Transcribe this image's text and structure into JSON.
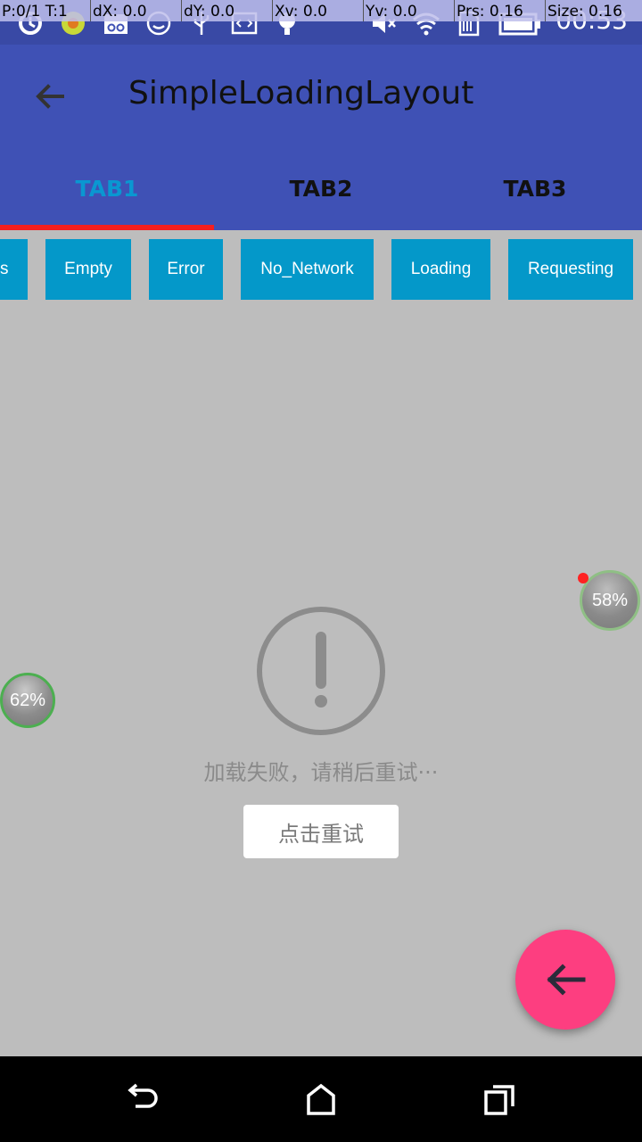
{
  "debug": {
    "p": "P:0/1 T:1",
    "dx": "dX: 0.0",
    "dy": "dY: 0.0",
    "xv": "Xv: 0.0",
    "yv": "Yv: 0.0",
    "prs": "Prs: 0.16",
    "size": "Size: 0.16"
  },
  "status_bar": {
    "time": "00:53",
    "icons": [
      "sync-icon",
      "app-icon",
      "incognito-icon",
      "face-icon",
      "usb-icon",
      "code-icon",
      "bulb-icon",
      "mute-icon",
      "wifi-icon",
      "no-sim-icon",
      "battery-icon"
    ]
  },
  "toolbar": {
    "title": "SimpleLoadingLayout"
  },
  "tabs": [
    {
      "label": "TAB1"
    },
    {
      "label": "TAB2"
    },
    {
      "label": "TAB3"
    }
  ],
  "state_buttons": [
    "s",
    "Empty",
    "Error",
    "No_Network",
    "Loading",
    "Requesting"
  ],
  "error_view": {
    "message": "加载失败，请稍后重试···",
    "retry_label": "点击重试"
  },
  "bubbles": {
    "right": "58%",
    "left": "62%"
  },
  "colors": {
    "primary": "#3f51b5",
    "tab_active": "#0a97d1",
    "indicator": "#f41f1f",
    "button": "#0498c9",
    "fab": "#fd3e80",
    "background": "#bdbdbd"
  }
}
